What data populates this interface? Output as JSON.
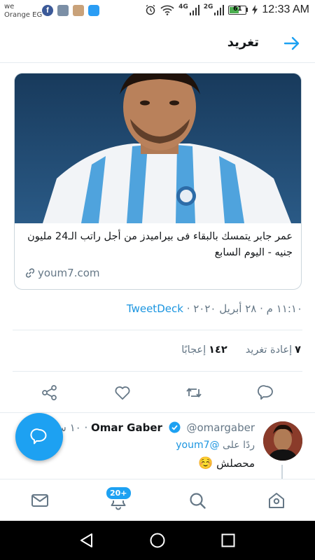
{
  "status_bar": {
    "carrier_line1": "we",
    "carrier_line2": "Orange EG",
    "network_4g": "4G",
    "network_2g": "2G",
    "battery": "61",
    "battery_level": 0.61,
    "time": "12:33 AM"
  },
  "header": {
    "title": "تغريد"
  },
  "card": {
    "title": "عمر جابر يتمسك بالبقاء فى بيراميدز من أجل راتب الـ24 مليون جنيه - اليوم السابع",
    "link": "youm7.com"
  },
  "tweet_meta": {
    "time": "١١:١٠ م",
    "date": "٢٨ أبريل ٢٠٢٠",
    "source": "TweetDeck",
    "sep": "·"
  },
  "stats": {
    "retweets_count": "٧",
    "retweets_label": "إعادة تغريد",
    "likes_count": "١٤٢",
    "likes_label": "إعجابًا"
  },
  "reply": {
    "name": "Omar Gaber",
    "handle": "@omargaber",
    "time": "١٠ س",
    "sep": "·",
    "replying_to_label": "ردًا على",
    "replying_to_handle": "@youm7",
    "text": "محصلش",
    "emoji": "☺️"
  },
  "bottom_nav": {
    "badge": "20+"
  },
  "colors": {
    "accent": "#1da1f2",
    "link": "#1b95e0",
    "muted": "#657786"
  }
}
